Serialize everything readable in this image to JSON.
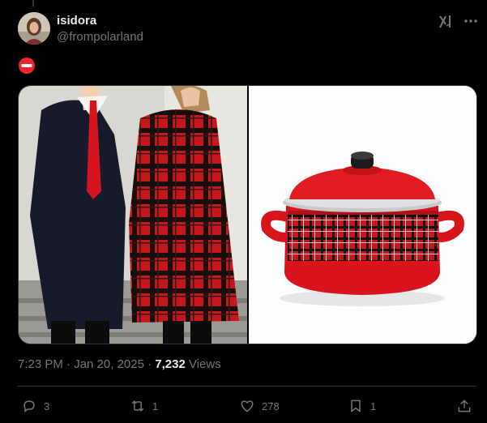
{
  "post": {
    "author": {
      "display_name": "isidora",
      "handle": "@frompolarland"
    },
    "emoji": "no-entry",
    "timestamp": "7:23 PM · Jan 20, 2025 · ",
    "views_count": "7,232",
    "views_label": " Views"
  },
  "actions": {
    "replies": "3",
    "reposts": "1",
    "likes": "278",
    "bookmarks": "1"
  },
  "icons": [
    "grok-icon",
    "more-icon",
    "no-entry-icon",
    "reply-icon",
    "repost-icon",
    "like-icon",
    "bookmark-icon",
    "share-icon"
  ],
  "colors": {
    "background": "#000000",
    "text_primary": "#e7e9ea",
    "text_secondary": "#71767b",
    "border": "#2f3336",
    "no_entry_red": "#f4212e"
  }
}
